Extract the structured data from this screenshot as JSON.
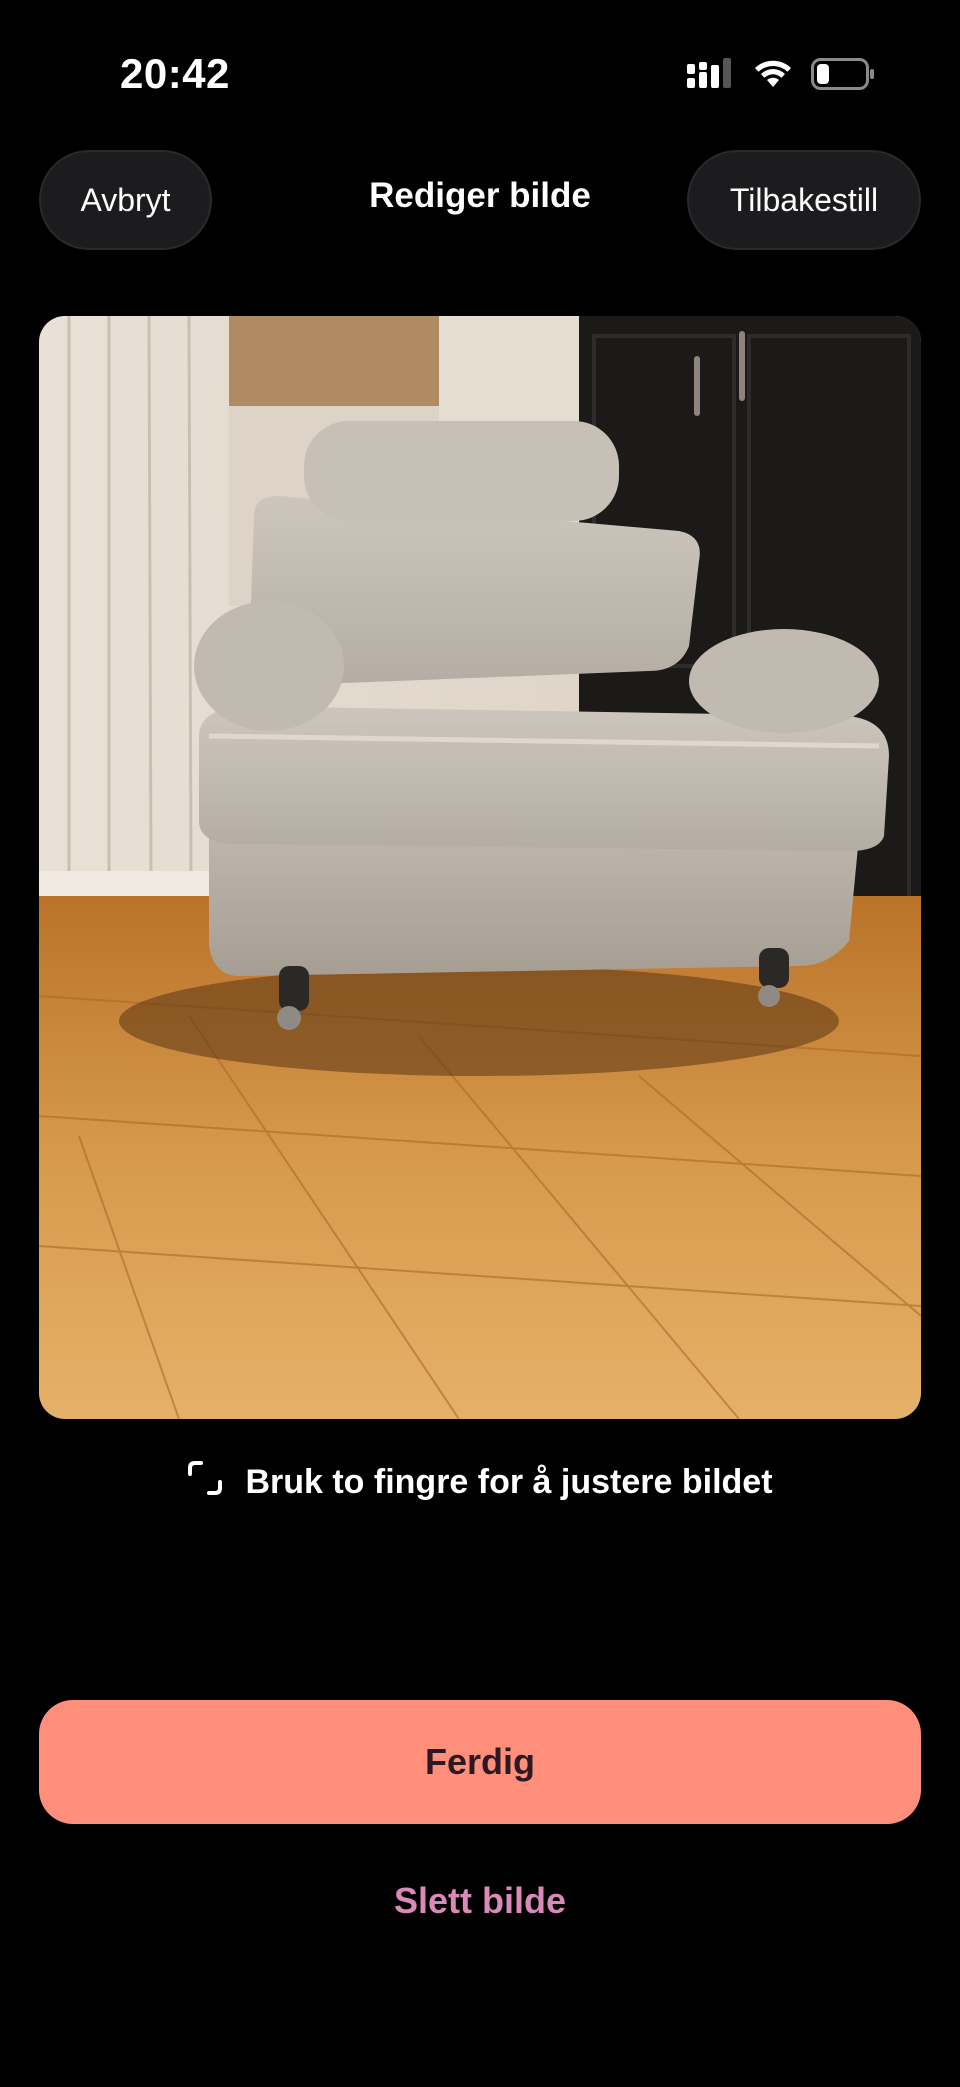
{
  "status_bar": {
    "time": "20:42"
  },
  "header": {
    "cancel_label": "Avbryt",
    "title": "Rediger bilde",
    "reset_label": "Tilbakestill"
  },
  "photo": {
    "subject": "armchair-photo"
  },
  "hint": {
    "icon": "crop-corners-icon",
    "text": "Bruk to fingre for å justere bildet"
  },
  "actions": {
    "done_label": "Ferdig",
    "delete_label": "Slett bilde"
  },
  "colors": {
    "accent": "#ff8f7a",
    "delete_text": "#d98ab8",
    "background": "#000000",
    "header_button_bg": "#1c1c1e"
  }
}
